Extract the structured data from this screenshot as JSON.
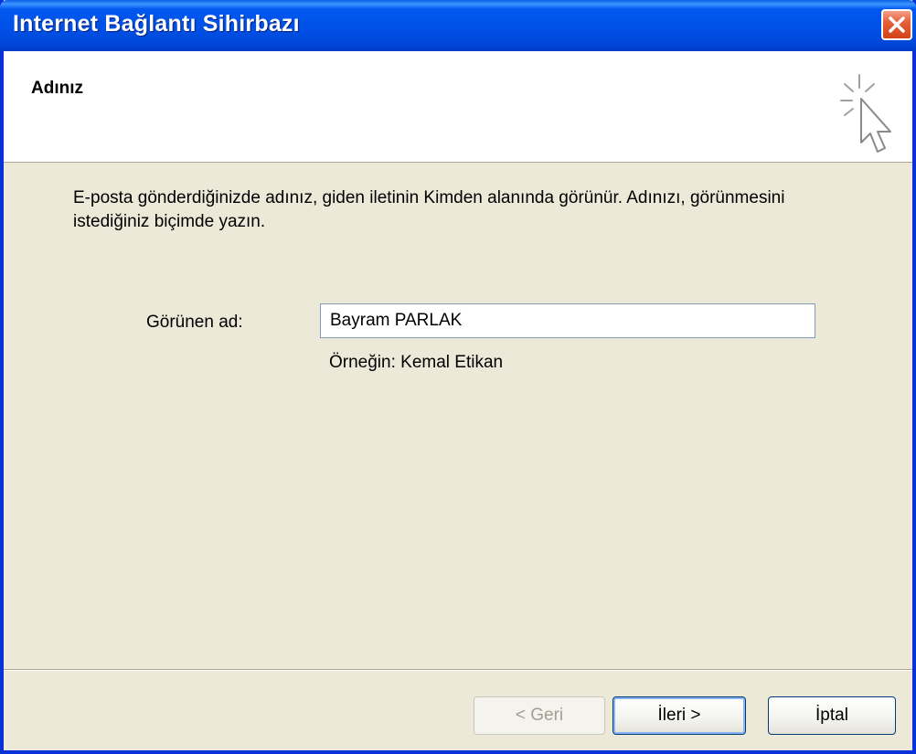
{
  "window": {
    "title": "Internet Bağlantı Sihirbazı"
  },
  "header": {
    "title": "Adınız"
  },
  "description": "E-posta gönderdiğinizde adınız, giden iletinin Kimden alanında görünür. Adınızı, görünmesini istediğiniz biçimde yazın.",
  "display_name": {
    "label": "Görünen ad:",
    "value": "Bayram PARLAK",
    "example": "Örneğin: Kemal Etikan"
  },
  "buttons": {
    "back": "< Geri",
    "next": "İleri >",
    "cancel": "İptal"
  },
  "icons": {
    "close": "close-icon",
    "wizard": "wizard-cursor-icon"
  },
  "colors": {
    "title_bar": "#0054e3",
    "close_button": "#e5603b",
    "dialog_face": "#ece9d8"
  }
}
